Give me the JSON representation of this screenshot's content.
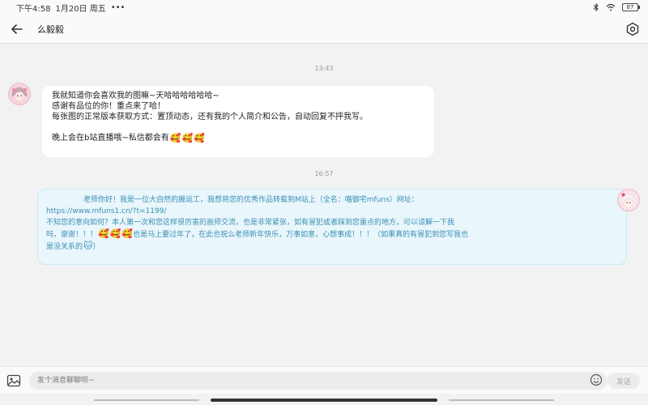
{
  "status_bar": {
    "time": "下午4:58",
    "date": "1月20日 周五",
    "more": "•••",
    "battery": "87"
  },
  "header": {
    "title": "么毅毅"
  },
  "messages": [
    {
      "timestamp": "13:43",
      "side": "left",
      "lines": [
        "我就知道你会喜欢我的图嘛~天哈哈哈哈哈哈~",
        "感谢有品位的你！重点来了哈！",
        "每张图的正常版本获取方式：置顶动态，还有我的个人简介和公告，自动回复不抨我写。",
        "",
        "晚上会在b站直播哦~私信都会有"
      ],
      "emojis": [
        "🥰",
        "🥰",
        "🥰"
      ]
    },
    {
      "timestamp": "16:57",
      "side": "right",
      "line1": "老师你好！我是一位大自然的搬运工，我想将您的优秀作品转载到M站上（全名：喵御宅mfuns）网址：",
      "line2": "https://www.mfuns1.cn/?t=1199/",
      "line3": "不知您的意向如何？本人第一次和您这样很厉害的画师交流，也是非常紧张，如有冒犯或者踩到您雷点的地方，可以谅解一下我",
      "line4_pre": "吗，谢谢！！！",
      "line4_emojis": [
        "🥰",
        "🥰",
        "🥰"
      ],
      "line4_post": "也是马上要过年了，在此也祝么老师新年快乐，万事如意，心想事成！！！（如果真的有冒犯到您写我也",
      "line5_pre": "是没关系的",
      "line5_emoji": "🐱",
      "line5_post": "）"
    }
  ],
  "input": {
    "placeholder": "发个消息聊聊呗~",
    "send_label": "发送"
  },
  "colors": {
    "right_bubble_text": "#3a8fb5",
    "right_bubble_bg": "#e9f6fb"
  }
}
